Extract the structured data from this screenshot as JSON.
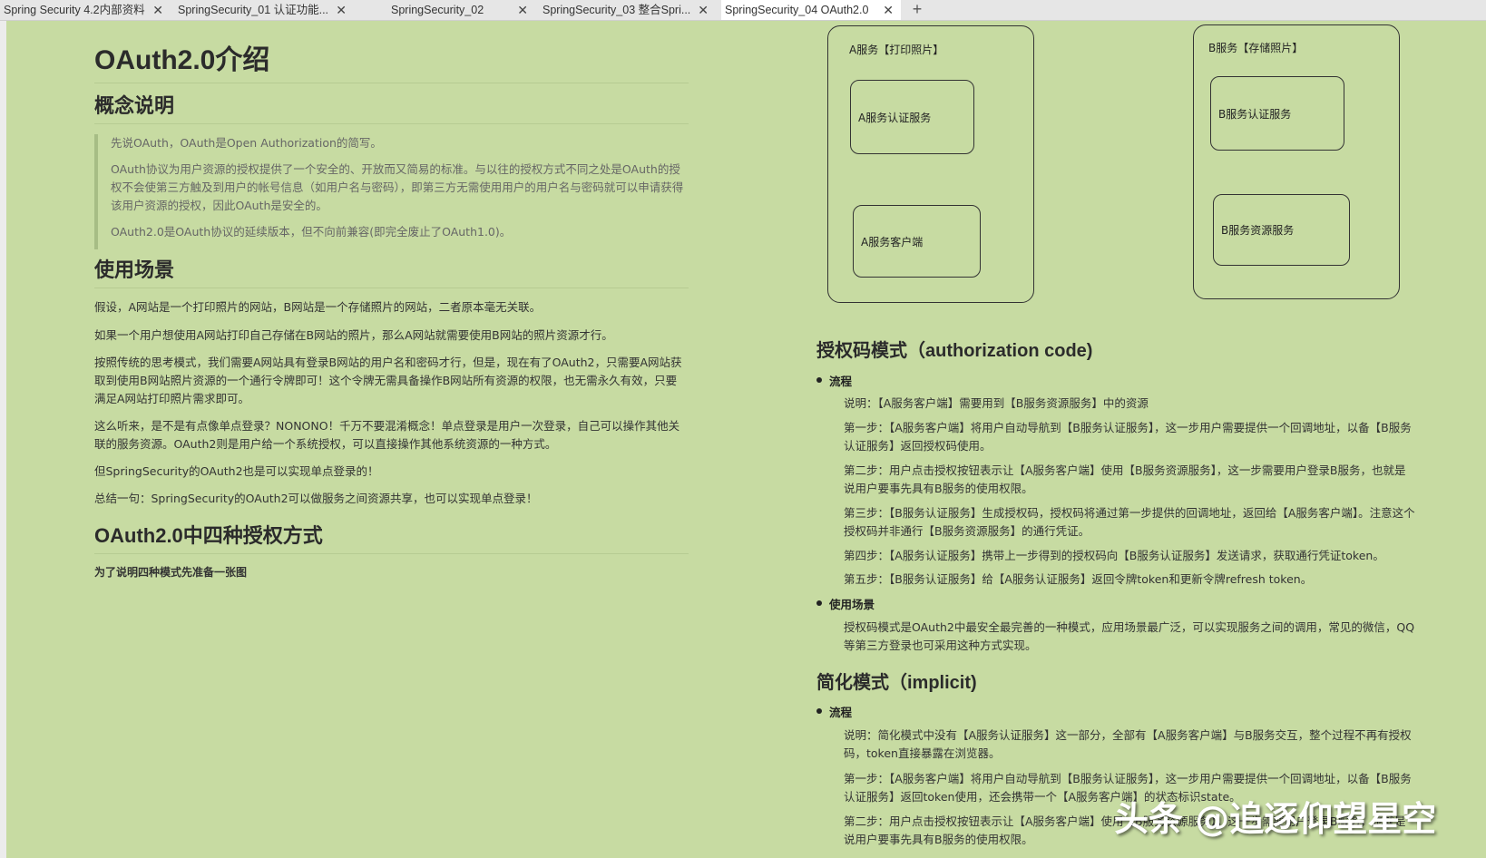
{
  "tabs": [
    {
      "label": "Spring Security 4.2内部资料",
      "active": false
    },
    {
      "label": "SpringSecurity_01 认证功能...",
      "active": false
    },
    {
      "label": "SpringSecurity_02",
      "active": false
    },
    {
      "label": "SpringSecurity_03   整合Spri...",
      "active": false
    },
    {
      "label": "SpringSecurity_04 OAuth2.0",
      "active": true
    }
  ],
  "icons": {
    "close": "close-icon",
    "new_tab": "plus-icon",
    "bullet": "bullet-icon"
  },
  "colors": {
    "page_background": "#c7dba2",
    "tab_active": "#ffffff",
    "tab_bar": "#e6e6e6"
  },
  "left": {
    "title": "OAuth2.0介绍",
    "concept_heading": "概念说明",
    "quote": [
      "先说OAuth，OAuth是Open Authorization的简写。",
      "OAuth协议为用户资源的授权提供了一个安全的、开放而又简易的标准。与以往的授权方式不同之处是OAuth的授权不会使第三方触及到用户的帐号信息（如用户名与密码），即第三方无需使用用户的用户名与密码就可以申请获得该用户资源的授权，因此OAuth是安全的。",
      "OAuth2.0是OAuth协议的延续版本，但不向前兼容(即完全废止了OAuth1.0)。"
    ],
    "scenario_heading": "使用场景",
    "scenario_paras": [
      "假设，A网站是一个打印照片的网站，B网站是一个存储照片的网站，二者原本毫无关联。",
      "如果一个用户想使用A网站打印自己存储在B网站的照片，那么A网站就需要使用B网站的照片资源才行。",
      "按照传统的思考模式，我们需要A网站具有登录B网站的用户名和密码才行，但是，现在有了OAuth2，只需要A网站获取到使用B网站照片资源的一个通行令牌即可！这个令牌无需具备操作B网站所有资源的权限，也无需永久有效，只要满足A网站打印照片需求即可。",
      "这么听来，是不是有点像单点登录？NONONO！千万不要混淆概念！单点登录是用户一次登录，自己可以操作其他关联的服务资源。OAuth2则是用户给一个系统授权，可以直接操作其他系统资源的一种方式。",
      "但SpringSecurity的OAuth2也是可以实现单点登录的！",
      "总结一句：SpringSecurity的OAuth2可以做服务之间资源共享，也可以实现单点登录！"
    ],
    "four_modes_heading": "OAuth2.0中四种授权方式",
    "four_modes_note": "为了说明四种模式先准备一张图"
  },
  "diagram": {
    "service_a_title": "A服务【打印照片】",
    "service_a_auth": "A服务认证服务",
    "service_a_client": "A服务客户端",
    "service_b_title": "B服务【存储照片】",
    "service_b_auth": "B服务认证服务",
    "service_b_resource": "B服务资源服务"
  },
  "right": {
    "authcode_heading": "授权码模式（authorization code)",
    "flow_label": "流程",
    "authcode_paras": [
      "说明：【A服务客户端】需要用到【B服务资源服务】中的资源",
      "第一步：【A服务客户端】将用户自动导航到【B服务认证服务】，这一步用户需要提供一个回调地址，以备【B服务认证服务】返回授权码使用。",
      "第二步：用户点击授权按钮表示让【A服务客户端】使用【B服务资源服务】，这一步需要用户登录B服务，也就是说用户要事先具有B服务的使用权限。",
      "第三步：【B服务认证服务】生成授权码，授权码将通过第一步提供的回调地址，返回给【A服务客户端】。注意这个授权码并非通行【B服务资源服务】的通行凭证。",
      "第四步：【A服务认证服务】携带上一步得到的授权码向【B服务认证服务】发送请求，获取通行凭证token。",
      "第五步：【B服务认证服务】给【A服务认证服务】返回令牌token和更新令牌refresh token。"
    ],
    "usage_label": "使用场景",
    "usage_para": "授权码模式是OAuth2中最安全最完善的一种模式，应用场景最广泛，可以实现服务之间的调用，常见的微信，QQ等第三方登录也可采用这种方式实现。",
    "implicit_heading": "简化模式（implicit)",
    "implicit_flow_label": "流程",
    "implicit_paras": [
      "说明：简化模式中没有【A服务认证服务】这一部分，全部有【A服务客户端】与B服务交互，整个过程不再有授权码，token直接暴露在浏览器。",
      "第一步：【A服务客户端】将用户自动导航到【B服务认证服务】，这一步用户需要提供一个回调地址，以备【B服务认证服务】返回token使用，还会携带一个【A服务客户端】的状态标识state。",
      "第二步：用户点击授权按钮表示让【A服务客户端】使用【B服务资源服务】，这一步需要用户登录B服务，也就是说用户要事先具有B服务的使用权限。"
    ]
  },
  "watermark": "头条 @追逐仰望星空"
}
